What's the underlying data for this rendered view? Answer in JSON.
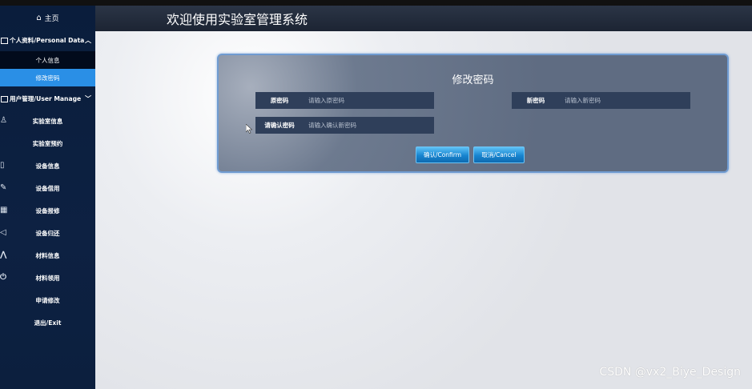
{
  "sidebar": {
    "home": "主页",
    "personal_section": "个人资料/Personal Data",
    "personal_items": [
      "个人信息",
      "修改密码"
    ],
    "user_section": "用户管理/User Manage",
    "items": [
      "实验室信息",
      "实验室预约",
      "设备信息",
      "设备借用",
      "设备报修",
      "设备归还",
      "材料信息",
      "材料领用",
      "申请修改",
      "退出/Exit"
    ]
  },
  "header": {
    "title": "欢迎使用实验室管理系统"
  },
  "form": {
    "title": "修改密码",
    "old_label": "原密码",
    "old_placeholder": "请输入原密码",
    "new_label": "新密码",
    "new_placeholder": "请输入新密码",
    "confirm_label": "请确认密码",
    "confirm_placeholder": "请输入确认新密码",
    "confirm_button": "确认/Confirm",
    "cancel_button": "取消/Cancel"
  },
  "watermark": "CSDN @vx2_Biye_Design",
  "colors": {
    "sidebar_bg": "#0a1d3c",
    "active_item": "#2a8fe6",
    "panel_border": "#6f9bd1"
  }
}
